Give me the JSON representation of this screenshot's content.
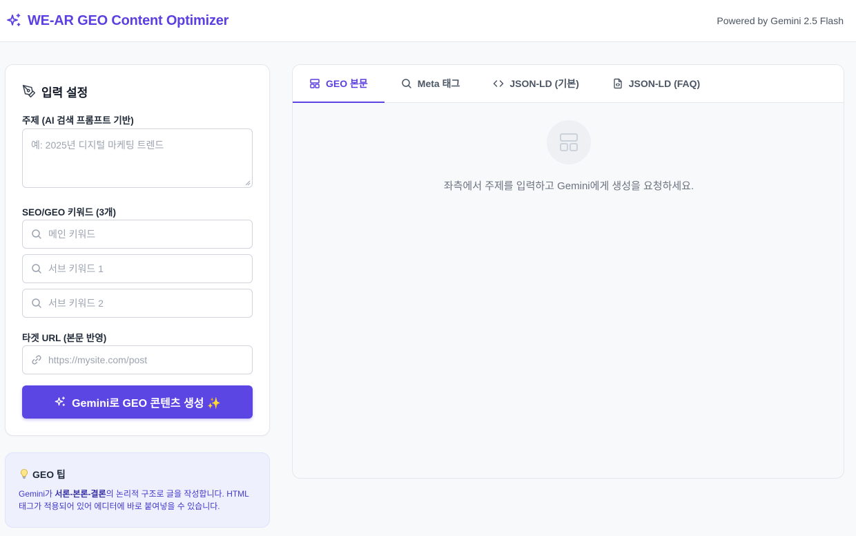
{
  "header": {
    "title": "WE-AR GEO Content Optimizer",
    "powered_by": "Powered by Gemini 2.5 Flash",
    "brand_color": "#5b3fe0"
  },
  "input_panel": {
    "title": "입력 설정",
    "topic_label": "주제 (AI 검색 프롬프트 기반)",
    "topic_placeholder": "예: 2025년 디지털 마케팅 트렌드",
    "topic_value": "",
    "keywords_label": "SEO/GEO 키워드 (3개)",
    "keywords": [
      {
        "placeholder": "메인 키워드",
        "value": ""
      },
      {
        "placeholder": "서브 키워드 1",
        "value": ""
      },
      {
        "placeholder": "서브 키워드 2",
        "value": ""
      }
    ],
    "url_label": "타겟 URL (본문 반영)",
    "url_placeholder": "https://mysite.com/post",
    "url_value": "",
    "generate_button": "Gemini로 GEO 콘텐츠 생성 ✨",
    "button_color": "#5b45e3"
  },
  "tip": {
    "title": "GEO 팁",
    "icon": "lightbulb-icon",
    "text_prefix": "Gemini가 ",
    "text_bold": "서론-본론-결론",
    "text_suffix": "의 논리적 구조로 글을 작성합니다. HTML 태그가 적용되어 있어 에디터에 바로 붙여넣을 수 있습니다."
  },
  "output": {
    "tabs": [
      {
        "label": "GEO 본문",
        "icon": "layout-icon",
        "active": true
      },
      {
        "label": "Meta 태그",
        "icon": "search-icon",
        "active": false
      },
      {
        "label": "JSON-LD (기본)",
        "icon": "code-icon",
        "active": false
      },
      {
        "label": "JSON-LD (FAQ)",
        "icon": "file-code-icon",
        "active": false
      }
    ],
    "empty_message": "좌측에서 주제를 입력하고 Gemini에게 생성을 요청하세요."
  }
}
